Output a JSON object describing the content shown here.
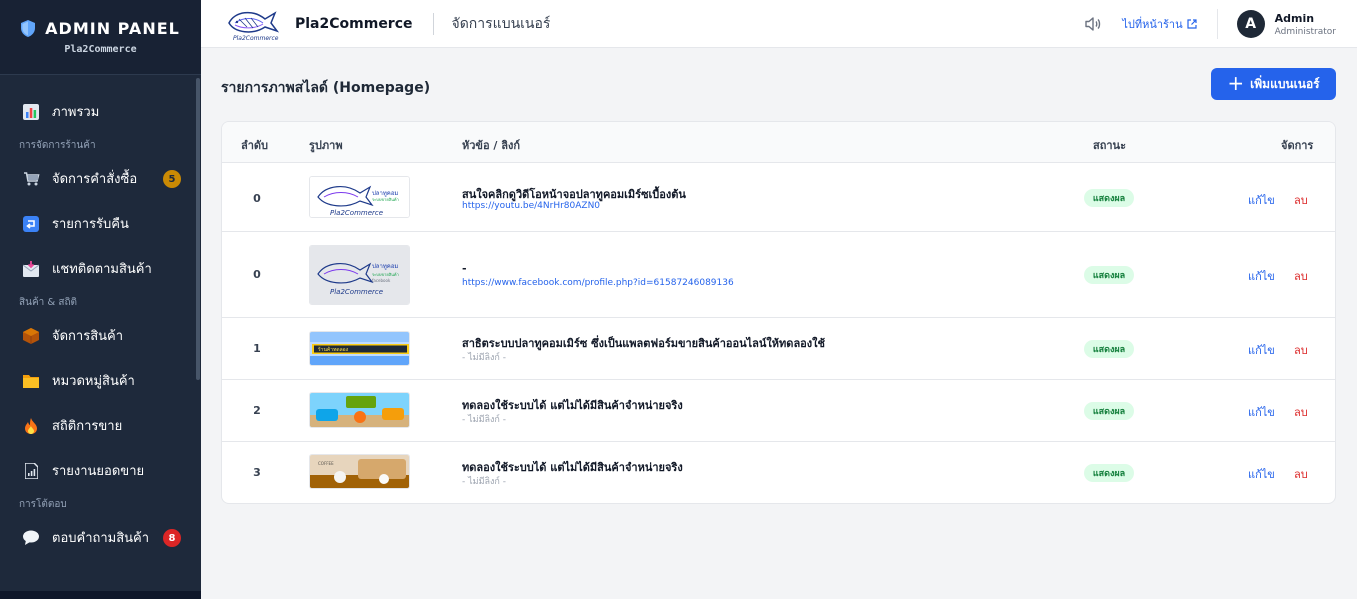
{
  "sidebar": {
    "title": "ADMIN PANEL",
    "subtitle": "Pla2Commerce",
    "overview": "ภาพรวม",
    "section_store": "การจัดการร้านค้า",
    "orders": "จัดการคำสั่งซื้อ",
    "orders_badge": "5",
    "returns": "รายการรับคืน",
    "chat": "แชทติดตามสินค้า",
    "section_products": "สินค้า & สถิติ",
    "products": "จัดการสินค้า",
    "categories": "หมวดหมู่สินค้า",
    "sales_stats": "สถิติการขาย",
    "sales_report": "รายงานยอดขาย",
    "section_interact": "การโต้ตอบ",
    "answers": "ตอบคำถามสินค้า",
    "answers_badge": "8"
  },
  "header": {
    "app_name": "Pla2Commerce",
    "page_name": "จัดการแบนเนอร์",
    "store_link": "ไปที่หน้าร้าน",
    "avatar_letter": "A",
    "user_name": "Admin",
    "user_role": "Administrator"
  },
  "main": {
    "title": "รายการภาพสไลด์ (Homepage)",
    "add_button": "เพิ่มแบนเนอร์"
  },
  "table": {
    "columns": {
      "order": "ลำดับ",
      "image": "รูปภาพ",
      "title_link": "หัวข้อ / ลิงก์",
      "status": "สถานะ",
      "actions": "จัดการ"
    },
    "rows": [
      {
        "order": "0",
        "title": "สนใจคลิกดูวิดีโอหน้าจอปลาทูคอมเมิร์ซเบื้องต้น",
        "link": "https://youtu.be/4NrHr80AZN0",
        "status": "แสดงผล",
        "edit": "แก้ไข",
        "delete": "ลบ"
      },
      {
        "order": "0",
        "title": "-",
        "link": "https://www.facebook.com/profile.php?id=61587246089136",
        "status": "แสดงผล",
        "edit": "แก้ไข",
        "delete": "ลบ"
      },
      {
        "order": "1",
        "title": "สาธิตระบบปลาทูคอมเมิร์ซ ซึ่งเป็นแพลตฟอร์มขายสินค้าออนไลน์ให้ทดลองใช้",
        "link": "- ไม่มีลิงก์ -",
        "status": "แสดงผล",
        "edit": "แก้ไข",
        "delete": "ลบ"
      },
      {
        "order": "2",
        "title": "ทดลองใช้ระบบได้ แต่ไม่ได้มีสินค้าจำหน่ายจริง",
        "link": "- ไม่มีลิงก์ -",
        "status": "แสดงผล",
        "edit": "แก้ไข",
        "delete": "ลบ"
      },
      {
        "order": "3",
        "title": "ทดลองใช้ระบบได้ แต่ไม่ได้มีสินค้าจำหน่ายจริง",
        "link": "- ไม่มีลิงก์ -",
        "status": "แสดงผล",
        "edit": "แก้ไข",
        "delete": "ลบ"
      }
    ]
  },
  "colors": {
    "sidebar_bg": "#1e293b",
    "accent": "#2563eb",
    "status_bg": "#dcfce7",
    "status_text": "#15803d",
    "danger": "#dc2626"
  }
}
